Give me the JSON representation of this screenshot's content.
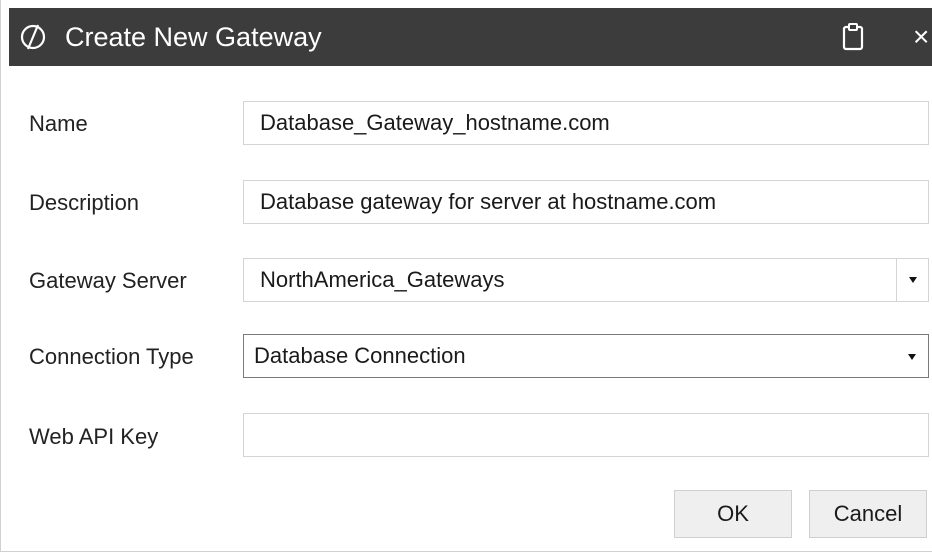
{
  "dialog": {
    "title": "Create New Gateway",
    "close_glyph": "×",
    "icons": {
      "app": "app-logo-icon",
      "clipboard": "clipboard-icon",
      "close": "close-icon"
    },
    "colors": {
      "titlebar": "#3c3c3c",
      "title_text": "#ffffff",
      "button_bg": "#efefef"
    }
  },
  "form": {
    "name": {
      "label": "Name",
      "value": "Database_Gateway_hostname.com"
    },
    "description": {
      "label": "Description",
      "value": "Database gateway for server at hostname.com"
    },
    "gateway_server": {
      "label": "Gateway Server",
      "value": "NorthAmerica_Gateways"
    },
    "connection_type": {
      "label": "Connection Type",
      "value": "Database Connection"
    },
    "web_api_key": {
      "label": "Web API Key",
      "value": ""
    }
  },
  "buttons": {
    "ok": "OK",
    "cancel": "Cancel"
  }
}
